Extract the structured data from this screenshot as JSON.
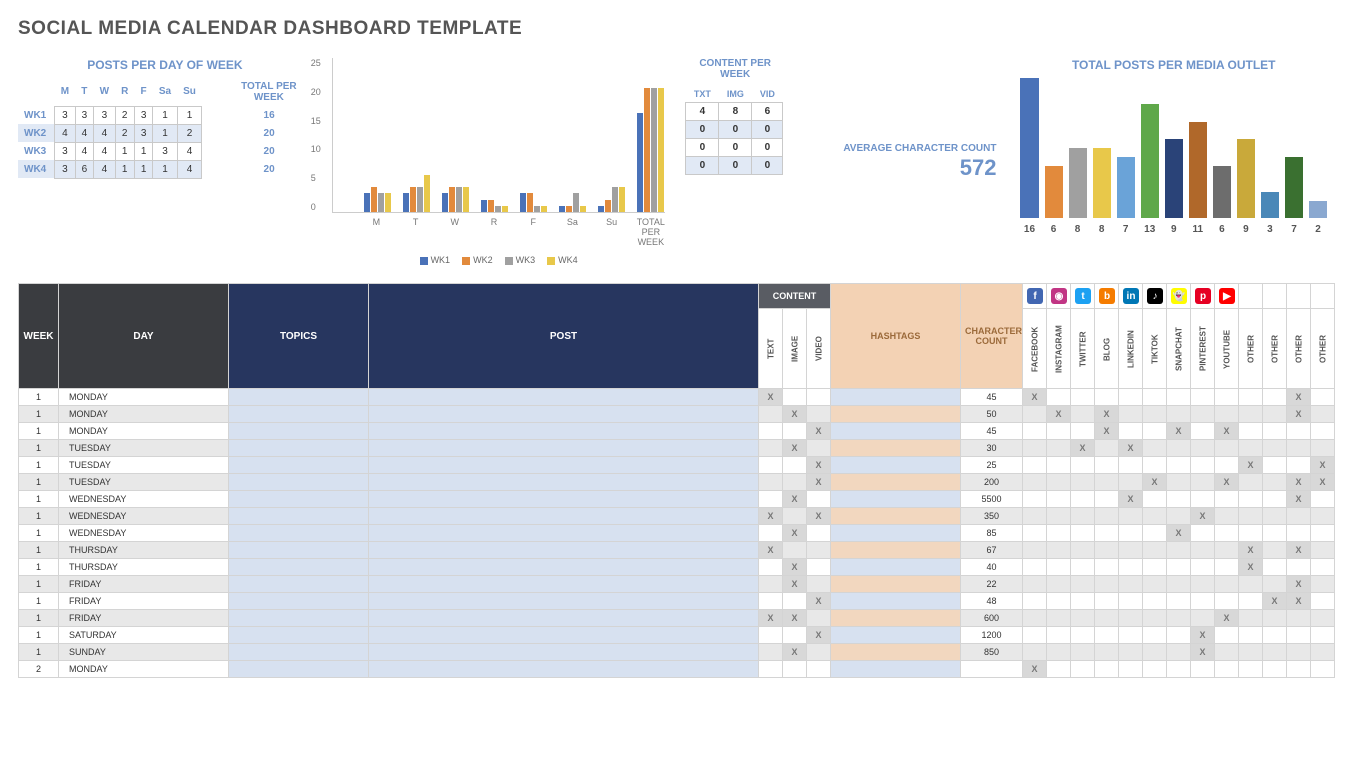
{
  "title": "SOCIAL MEDIA CALENDAR DASHBOARD TEMPLATE",
  "ppd": {
    "title": "POSTS PER DAY OF WEEK",
    "totalhdr": "TOTAL PER WEEK",
    "days": [
      "M",
      "T",
      "W",
      "R",
      "F",
      "Sa",
      "Su"
    ],
    "rows": [
      {
        "lbl": "WK1",
        "v": [
          3,
          3,
          3,
          2,
          3,
          1,
          1
        ],
        "t": 16
      },
      {
        "lbl": "WK2",
        "v": [
          4,
          4,
          4,
          2,
          3,
          1,
          2
        ],
        "t": 20
      },
      {
        "lbl": "WK3",
        "v": [
          3,
          4,
          4,
          1,
          1,
          3,
          4
        ],
        "t": 20
      },
      {
        "lbl": "WK4",
        "v": [
          3,
          6,
          4,
          1,
          1,
          1,
          4
        ],
        "t": 20
      }
    ]
  },
  "chart_data": {
    "type": "bar",
    "title": "",
    "xlabel": "",
    "ylabel": "",
    "ylim": [
      0,
      25
    ],
    "yticks": [
      25,
      20,
      15,
      10,
      5,
      0
    ],
    "categories": [
      "M",
      "T",
      "W",
      "R",
      "F",
      "Sa",
      "Su",
      "TOTAL PER WEEK"
    ],
    "series": [
      {
        "name": "WK1",
        "values": [
          3,
          3,
          3,
          2,
          3,
          1,
          1,
          16
        ]
      },
      {
        "name": "WK2",
        "values": [
          4,
          4,
          4,
          2,
          3,
          1,
          2,
          20
        ]
      },
      {
        "name": "WK3",
        "values": [
          3,
          4,
          4,
          1,
          1,
          3,
          4,
          20
        ]
      },
      {
        "name": "WK4",
        "values": [
          3,
          6,
          4,
          1,
          1,
          1,
          4,
          20
        ]
      }
    ]
  },
  "cpw": {
    "title": "CONTENT PER WEEK",
    "cols": [
      "TXT",
      "IMG",
      "VID"
    ],
    "rows": [
      [
        4,
        8,
        6
      ],
      [
        0,
        0,
        0
      ],
      [
        0,
        0,
        0
      ],
      [
        0,
        0,
        0
      ]
    ]
  },
  "avg": {
    "lbl": "AVERAGE CHARACTER COUNT",
    "val": 572
  },
  "outlets": {
    "title": "TOTAL POSTS PER MEDIA OUTLET",
    "items": [
      {
        "v": 16,
        "c": "#4a72b8"
      },
      {
        "v": 6,
        "c": "#e28a3c"
      },
      {
        "v": 8,
        "c": "#a0a0a0"
      },
      {
        "v": 8,
        "c": "#e8c84a"
      },
      {
        "v": 7,
        "c": "#6aa3d8"
      },
      {
        "v": 13,
        "c": "#5fa84a"
      },
      {
        "v": 9,
        "c": "#2a4378"
      },
      {
        "v": 11,
        "c": "#b0682a"
      },
      {
        "v": 6,
        "c": "#6d6d6d"
      },
      {
        "v": 9,
        "c": "#c9a93a"
      },
      {
        "v": 3,
        "c": "#4a88b8"
      },
      {
        "v": 7,
        "c": "#3a7030"
      },
      {
        "v": 2,
        "c": "#8aa8d0"
      }
    ]
  },
  "gridh": {
    "week": "WEEK",
    "day": "DAY",
    "topics": "TOPICS",
    "post": "POST",
    "content": "CONTENT",
    "hashtags": "HASHTAGS",
    "charcount": "CHARACTER COUNT",
    "cols": [
      "TEXT",
      "IMAGE",
      "VIDEO"
    ],
    "media": [
      "FACEBOOK",
      "INSTAGRAM",
      "TWITTER",
      "BLOG",
      "LINKEDIN",
      "TIKTOK",
      "SNAPCHAT",
      "PINTEREST",
      "YOUTUBE",
      "OTHER",
      "OTHER",
      "OTHER",
      "OTHER"
    ],
    "icons": [
      {
        "t": "f",
        "c": "#4267b2"
      },
      {
        "t": "◉",
        "c": "#c13584"
      },
      {
        "t": "t",
        "c": "#1da1f2"
      },
      {
        "t": "b",
        "c": "#f57c00"
      },
      {
        "t": "in",
        "c": "#0077b5"
      },
      {
        "t": "♪",
        "c": "#000"
      },
      {
        "t": "👻",
        "c": "#fffc00"
      },
      {
        "t": "p",
        "c": "#e60023"
      },
      {
        "t": "▶",
        "c": "#ff0000"
      },
      {
        "t": "",
        "c": "#fff"
      },
      {
        "t": "",
        "c": "#fff"
      },
      {
        "t": "",
        "c": "#fff"
      },
      {
        "t": "",
        "c": "#fff"
      }
    ]
  },
  "rows": [
    {
      "w": 1,
      "d": "MONDAY",
      "txt": "X",
      "img": "",
      "vid": "",
      "cc": 45,
      "m": [
        1,
        0,
        0,
        0,
        0,
        0,
        0,
        0,
        0,
        0,
        0,
        1,
        0
      ]
    },
    {
      "w": 1,
      "d": "MONDAY",
      "txt": "",
      "img": "X",
      "vid": "",
      "cc": 50,
      "m": [
        0,
        1,
        0,
        1,
        0,
        0,
        0,
        0,
        0,
        0,
        0,
        1,
        0
      ],
      "peach": 1
    },
    {
      "w": 1,
      "d": "MONDAY",
      "txt": "",
      "img": "",
      "vid": "X",
      "cc": 45,
      "m": [
        0,
        0,
        0,
        1,
        0,
        0,
        1,
        0,
        1,
        0,
        0,
        0,
        0
      ]
    },
    {
      "w": 1,
      "d": "TUESDAY",
      "txt": "",
      "img": "X",
      "vid": "",
      "cc": 30,
      "m": [
        0,
        0,
        1,
        0,
        1,
        0,
        0,
        0,
        0,
        0,
        0,
        0,
        0
      ],
      "peach": 1
    },
    {
      "w": 1,
      "d": "TUESDAY",
      "txt": "",
      "img": "",
      "vid": "X",
      "cc": 25,
      "m": [
        0,
        0,
        0,
        0,
        0,
        0,
        0,
        0,
        0,
        1,
        0,
        0,
        1
      ]
    },
    {
      "w": 1,
      "d": "TUESDAY",
      "txt": "",
      "img": "",
      "vid": "X",
      "cc": 200,
      "m": [
        0,
        0,
        0,
        0,
        0,
        1,
        0,
        0,
        1,
        0,
        0,
        1,
        1
      ],
      "peach": 1
    },
    {
      "w": 1,
      "d": "WEDNESDAY",
      "txt": "",
      "img": "X",
      "vid": "",
      "cc": 5500,
      "m": [
        0,
        0,
        0,
        0,
        1,
        0,
        0,
        0,
        0,
        0,
        0,
        1,
        0
      ]
    },
    {
      "w": 1,
      "d": "WEDNESDAY",
      "txt": "X",
      "img": "",
      "vid": "X",
      "cc": 350,
      "m": [
        0,
        0,
        0,
        0,
        0,
        0,
        0,
        1,
        0,
        0,
        0,
        0,
        0
      ],
      "peach": 1
    },
    {
      "w": 1,
      "d": "WEDNESDAY",
      "txt": "",
      "img": "X",
      "vid": "",
      "cc": 85,
      "m": [
        0,
        0,
        0,
        0,
        0,
        0,
        1,
        0,
        0,
        0,
        0,
        0,
        0
      ]
    },
    {
      "w": 1,
      "d": "THURSDAY",
      "txt": "X",
      "img": "",
      "vid": "",
      "cc": 67,
      "m": [
        0,
        0,
        0,
        0,
        0,
        0,
        0,
        0,
        0,
        1,
        0,
        1,
        0
      ],
      "peach": 1
    },
    {
      "w": 1,
      "d": "THURSDAY",
      "txt": "",
      "img": "X",
      "vid": "",
      "cc": 40,
      "m": [
        0,
        0,
        0,
        0,
        0,
        0,
        0,
        0,
        0,
        1,
        0,
        0,
        0
      ]
    },
    {
      "w": 1,
      "d": "FRIDAY",
      "txt": "",
      "img": "X",
      "vid": "",
      "cc": 22,
      "m": [
        0,
        0,
        0,
        0,
        0,
        0,
        0,
        0,
        0,
        0,
        0,
        1,
        0
      ],
      "peach": 1
    },
    {
      "w": 1,
      "d": "FRIDAY",
      "txt": "",
      "img": "",
      "vid": "X",
      "cc": 48,
      "m": [
        0,
        0,
        0,
        0,
        0,
        0,
        0,
        0,
        0,
        0,
        1,
        1,
        0
      ]
    },
    {
      "w": 1,
      "d": "FRIDAY",
      "txt": "X",
      "img": "X",
      "vid": "",
      "cc": 600,
      "m": [
        0,
        0,
        0,
        0,
        0,
        0,
        0,
        0,
        1,
        0,
        0,
        0,
        0
      ],
      "peach": 1
    },
    {
      "w": 1,
      "d": "SATURDAY",
      "txt": "",
      "img": "",
      "vid": "X",
      "cc": 1200,
      "m": [
        0,
        0,
        0,
        0,
        0,
        0,
        0,
        1,
        0,
        0,
        0,
        0,
        0
      ]
    },
    {
      "w": 1,
      "d": "SUNDAY",
      "txt": "",
      "img": "X",
      "vid": "",
      "cc": 850,
      "m": [
        0,
        0,
        0,
        0,
        0,
        0,
        0,
        1,
        0,
        0,
        0,
        0,
        0
      ],
      "peach": 1
    },
    {
      "w": 2,
      "d": "MONDAY",
      "txt": "",
      "img": "",
      "vid": "",
      "cc": "",
      "m": [
        1,
        0,
        0,
        0,
        0,
        0,
        0,
        0,
        0,
        0,
        0,
        0,
        0
      ]
    }
  ]
}
